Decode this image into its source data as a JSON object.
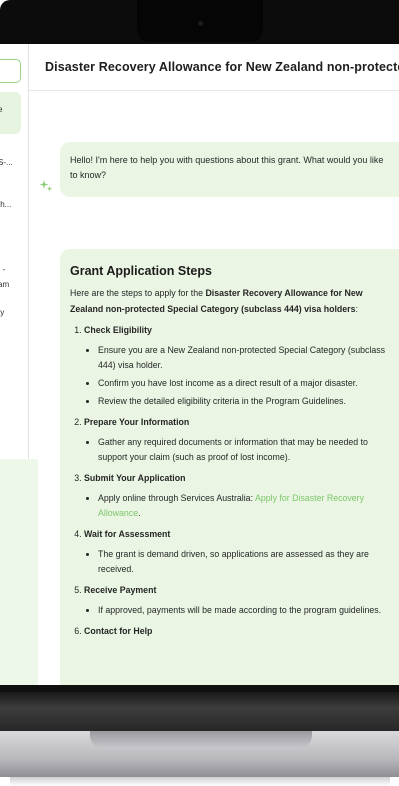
{
  "header": {
    "title": "Disaster Recovery Allowance for New Zealand non-protecte"
  },
  "sidebar": {
    "items": [
      {
        "label": "e",
        "top": 0
      },
      {
        "label": "S-...",
        "top": 0
      },
      {
        "label": ".",
        "top": 0
      },
      {
        "label": "th...",
        "top": 0
      },
      {
        "label": "I -",
        "top": 0
      },
      {
        "label": "am",
        "top": 0
      },
      {
        "label": "ty",
        "top": 0
      }
    ]
  },
  "chat": {
    "greeting": "Hello! I'm here to help you with questions about this grant. What would you like to know?",
    "answer": {
      "heading": "Grant Application Steps",
      "intro_prefix": "Here are the steps to apply for the ",
      "intro_bold": "Disaster Recovery Allowance for New Zealand non-protected Special Category (subclass 444) visa holders",
      "intro_suffix": ":",
      "steps": [
        {
          "title": "Check Eligibility",
          "bullets": [
            "Ensure you are a New Zealand non-protected Special Category (subclass 444) visa holder.",
            "Confirm you have lost income as a direct result of a major disaster.",
            "Review the detailed eligibility criteria in the Program Guidelines."
          ]
        },
        {
          "title": "Prepare Your Information",
          "bullets": [
            "Gather any required documents or information that may be needed to support your claim (such as proof of lost income)."
          ]
        },
        {
          "title": "Submit Your Application",
          "bullet_prefix": "Apply online through Services Australia: ",
          "link_text": "Apply for Disaster Recovery Allowance",
          "bullet_suffix": "."
        },
        {
          "title": "Wait for Assessment",
          "bullets": [
            "The grant is demand driven, so applications are assessed as they are received."
          ]
        },
        {
          "title": "Receive Payment",
          "bullets": [
            "If approved, payments will be made according to the program guidelines."
          ]
        },
        {
          "title": "Contact for Help",
          "bullets": []
        }
      ]
    }
  }
}
